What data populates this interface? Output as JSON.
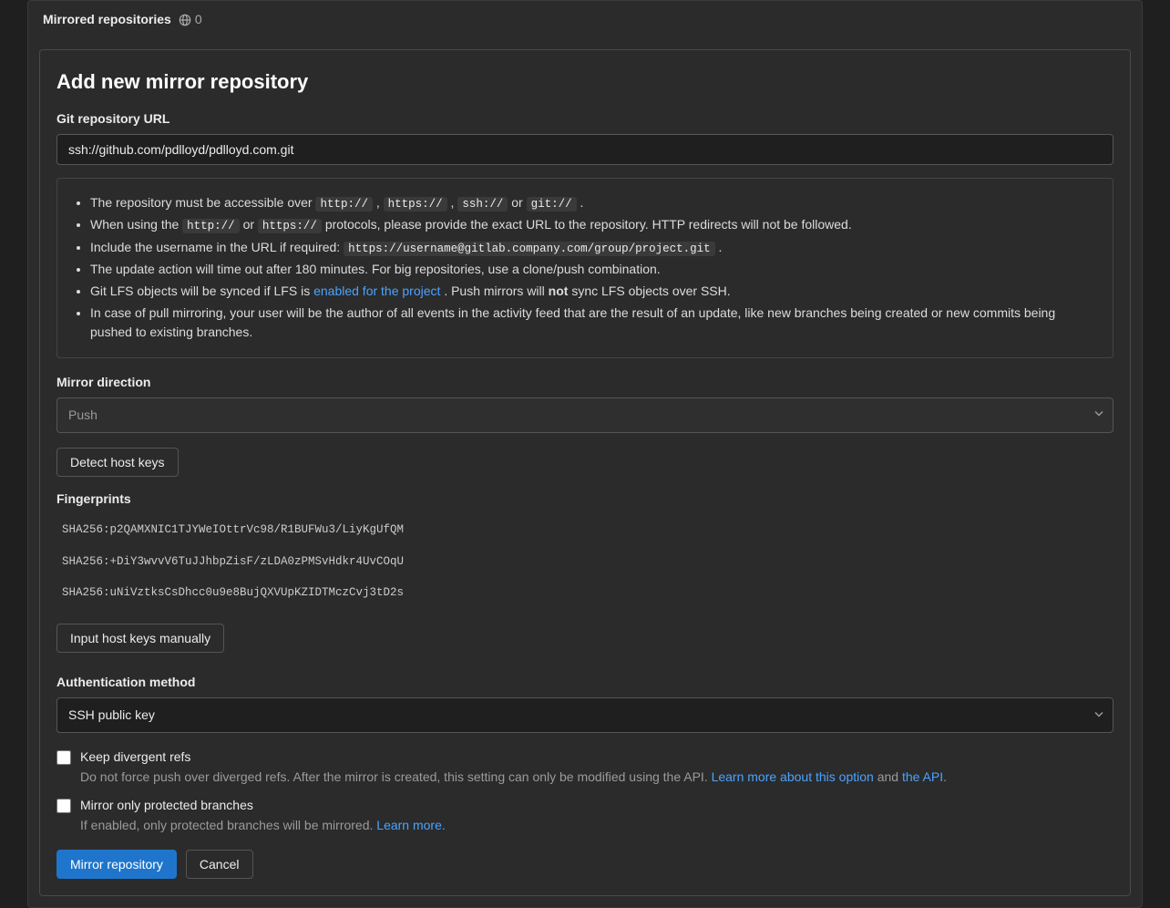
{
  "header": {
    "title": "Mirrored repositories",
    "count": "0"
  },
  "card": {
    "title": "Add new mirror repository",
    "url_label": "Git repository URL",
    "url_value": "ssh://github.com/pdlloyd/pdlloyd.com.git"
  },
  "info": {
    "li1_a": "The repository must be accessible over ",
    "li1_http": "http://",
    "li1_comma1": " , ",
    "li1_https": "https://",
    "li1_comma2": " , ",
    "li1_ssh": "ssh://",
    "li1_or": " or ",
    "li1_git": "git://",
    "li1_dot": " .",
    "li2_a": "When using the ",
    "li2_http": "http://",
    "li2_or": " or ",
    "li2_https": "https://",
    "li2_b": " protocols, please provide the exact URL to the repository. HTTP redirects will not be followed.",
    "li3_a": "Include the username in the URL if required: ",
    "li3_code": "https://username@gitlab.company.com/group/project.git",
    "li3_dot": " .",
    "li4": "The update action will time out after 180 minutes. For big repositories, use a clone/push combination.",
    "li5_a": "Git LFS objects will be synced if LFS is ",
    "li5_link": "enabled for the project",
    "li5_b": ". Push mirrors will ",
    "li5_not": "not",
    "li5_c": " sync LFS objects over SSH.",
    "li6": "In case of pull mirroring, your user will be the author of all events in the activity feed that are the result of an update, like new branches being created or new commits being pushed to existing branches."
  },
  "direction": {
    "label": "Mirror direction",
    "value": "Push"
  },
  "detect_btn": "Detect host keys",
  "fingerprints": {
    "label": "Fingerprints",
    "fp1": "SHA256:p2QAMXNIC1TJYWeIOttrVc98/R1BUFWu3/LiyKgUfQM",
    "fp2": "SHA256:+DiY3wvvV6TuJJhbpZisF/zLDA0zPMSvHdkr4UvCOqU",
    "fp3": "SHA256:uNiVztksCsDhcc0u9e8BujQXVUpKZIDTMczCvj3tD2s"
  },
  "manual_btn": "Input host keys manually",
  "auth": {
    "label": "Authentication method",
    "value": "SSH public key"
  },
  "check1": {
    "label": "Keep divergent refs",
    "desc_a": "Do not force push over diverged refs. After the mirror is created, this setting can only be modified using the API. ",
    "link1": "Learn more about this option",
    "and": " and ",
    "link2": "the API",
    "dot": "."
  },
  "check2": {
    "label": "Mirror only protected branches",
    "desc_a": "If enabled, only protected branches will be mirrored. ",
    "link": "Learn more."
  },
  "buttons": {
    "primary": "Mirror repository",
    "cancel": "Cancel"
  }
}
